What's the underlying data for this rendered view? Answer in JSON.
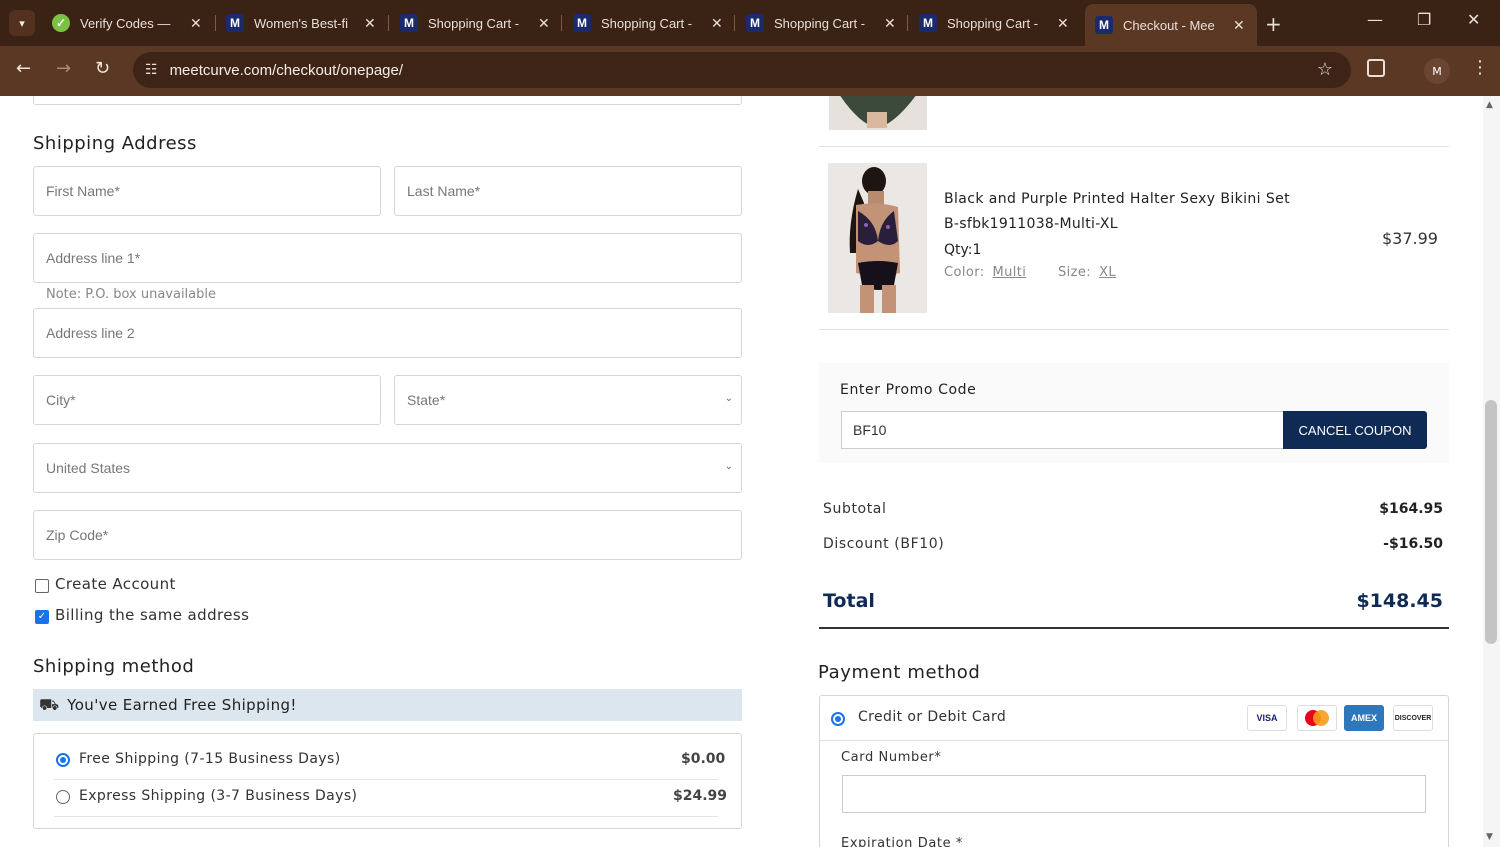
{
  "browser": {
    "tabs": [
      {
        "title": "Verify Codes —",
        "favicon": "check-icon"
      },
      {
        "title": "Women's Best-fi",
        "favicon": "meetcurve-icon"
      },
      {
        "title": "Shopping Cart -",
        "favicon": "meetcurve-icon"
      },
      {
        "title": "Shopping Cart -",
        "favicon": "meetcurve-icon"
      },
      {
        "title": "Shopping Cart -",
        "favicon": "meetcurve-icon"
      },
      {
        "title": "Shopping Cart -",
        "favicon": "meetcurve-icon"
      },
      {
        "title": "Checkout - Mee",
        "favicon": "meetcurve-icon",
        "active": true
      }
    ],
    "url": "meetcurve.com/checkout/onepage/",
    "profile_initial": "M"
  },
  "shipping": {
    "heading": "Shipping Address",
    "first_name_placeholder": "First Name*",
    "last_name_placeholder": "Last Name*",
    "address1_placeholder": "Address line 1*",
    "po_note": "Note: P.O. box unavailable",
    "address2_placeholder": "Address line 2",
    "city_placeholder": "City*",
    "state_placeholder": "State*",
    "country_value": "United States",
    "zip_placeholder": "Zip Code*",
    "create_account_label": "Create Account",
    "billing_same_label": "Billing the same address",
    "create_account_checked": false,
    "billing_same_checked": true
  },
  "shipping_method": {
    "heading": "Shipping method",
    "banner": "You've Earned Free Shipping!",
    "options": [
      {
        "label": "Free Shipping (7-15 Business Days)",
        "price": "$0.00",
        "selected": true
      },
      {
        "label": "Express Shipping (3-7 Business Days)",
        "price": "$24.99",
        "selected": false
      }
    ]
  },
  "cart_item": {
    "title": "Black and Purple Printed Halter Sexy Bikini Set",
    "sku": "B-sfbk1911038-Multi-XL",
    "qty": "Qty:1",
    "color_label": "Color:",
    "color_value": "Multi",
    "size_label": "Size:",
    "size_value": "XL",
    "price": "$37.99"
  },
  "promo": {
    "label": "Enter Promo Code",
    "value": "BF10",
    "button": "CANCEL COUPON"
  },
  "summary": {
    "subtotal_label": "Subtotal",
    "subtotal_value": "$164.95",
    "discount_label": "Discount (BF10)",
    "discount_value": "-$16.50",
    "total_label": "Total",
    "total_value": "$148.45"
  },
  "payment": {
    "heading": "Payment method",
    "option_label": "Credit or Debit Card",
    "card_logos": [
      "VISA",
      "mastercard",
      "AMEX",
      "DISCOVER"
    ],
    "card_number_label": "Card Number*",
    "expiration_label": "Expiration Date *"
  },
  "colors": {
    "accent_navy": "#0f2b55",
    "radio_blue": "#1a73e8",
    "banner_bg": "#dbe6ef",
    "chrome_brown": "#5a3823"
  }
}
